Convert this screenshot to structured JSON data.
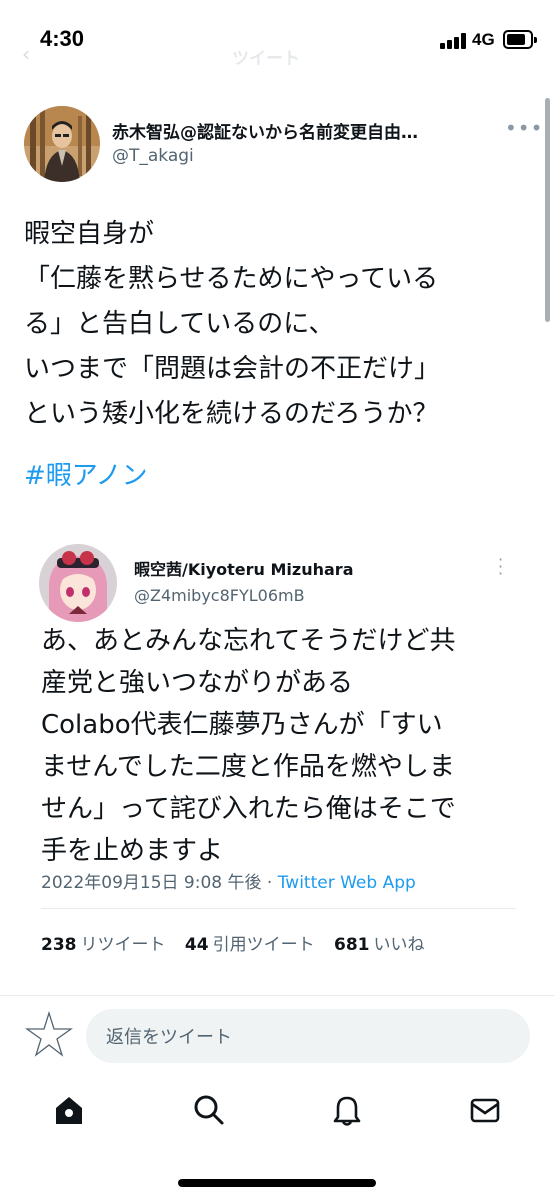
{
  "status_bar": {
    "time": "4:30",
    "network": "4G"
  },
  "header": {
    "back_icon": "back-arrow-icon",
    "title": "ツイート"
  },
  "tweet": {
    "author_name": "赤木智弘@認証ないから名前変更自由…",
    "author_handle": "@T_akagi",
    "more_icon": "more-horizontal-icon",
    "text_lines": [
      "暇空自身が",
      "「仁藤を黙らせるためにやっている",
      "る」と告白しているのに、",
      "いつまで「問題は会計の不正だけ」",
      "という矮小化を続けるのだろうか？"
    ],
    "hashtag": "#暇アノン"
  },
  "quoted_tweet": {
    "author_name": "暇空茜/Kiyoteru Mizuhara",
    "author_handle": "@Z4mibyc8FYL06mB",
    "more_icon": "more-vertical-icon",
    "text_lines": [
      "あ、あとみんな忘れてそうだけど共",
      "産党と強いつながりがある",
      "Colabo代表仁藤夢乃さんが「すい",
      "ませんでした二度と作品を燃やしま",
      "せん」って詫び入れたら俺はそこで",
      "手を止めますよ"
    ],
    "timestamp": "2022年09月15日 9:08 午後 · ",
    "source": "Twitter Web App",
    "retweets_count": "238",
    "retweets_label": "リツイート",
    "quotes_count": "44",
    "quotes_label": "引用ツイート",
    "likes_count": "681",
    "likes_label": "いいね"
  },
  "reply": {
    "placeholder": "返信をツイート",
    "avatar_icon": "default-avatar-star-icon"
  },
  "bottom_nav": {
    "items": [
      {
        "icon": "home-icon",
        "active": true
      },
      {
        "icon": "search-icon"
      },
      {
        "icon": "notifications-bell-icon"
      },
      {
        "icon": "messages-envelope-icon"
      }
    ]
  },
  "colors": {
    "accent": "#1d9bf0",
    "text": "#0f1419",
    "secondary": "#536471",
    "input_bg": "#eff3f4"
  }
}
